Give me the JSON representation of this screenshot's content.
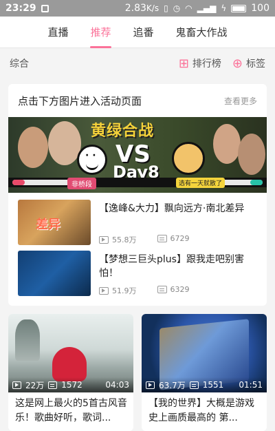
{
  "status": {
    "time": "23:29",
    "speed": "2.83",
    "speed_unit": "K/s",
    "battery": "100"
  },
  "tabs": [
    {
      "label": "直播",
      "active": false
    },
    {
      "label": "推荐",
      "active": true
    },
    {
      "label": "追番",
      "active": false
    },
    {
      "label": "鬼畜大作战",
      "active": false
    }
  ],
  "subbar": {
    "general": "综合",
    "rank": "排行榜",
    "tags": "标签"
  },
  "activity_card": {
    "title": "点击下方图片进入活动页面",
    "more": "查看更多",
    "banner": {
      "title": "黄绿合战",
      "vs": "VS",
      "day": "Day8",
      "left_tag": "非桥段",
      "right_tag": "选有一天就散了"
    },
    "videos": [
      {
        "title": "【逸峰&大力】飘向远方·南北差异",
        "thumb_text": "差异",
        "views": "55.8万",
        "danmaku": "6729"
      },
      {
        "title": "【梦想三巨头plus】跟我走吧别害怕！",
        "views": "51.9万",
        "danmaku": "6329"
      }
    ]
  },
  "grid": [
    {
      "views": "22万",
      "danmaku": "1572",
      "duration": "04:03",
      "title": "这是网上最火的5首古风音乐！歌曲好听，歌词..."
    },
    {
      "views": "63.7万",
      "danmaku": "1551",
      "duration": "01:51",
      "title": "【我的世界】大概是游戏史上画质最高的 第..."
    }
  ],
  "colors": {
    "accent": "#fb7299",
    "status_bar": "#9a9a9a",
    "card_bg": "#ffffff",
    "page_bg": "#f4f4f4"
  }
}
